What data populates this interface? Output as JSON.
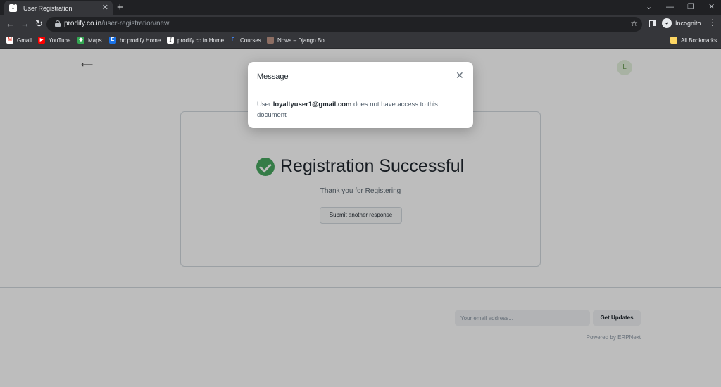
{
  "browser": {
    "tab_title": "User Registration",
    "tab_favicon": "f",
    "url_host": "prodify.co.in",
    "url_path": "/user-registration/new",
    "profile_label": "Incognito",
    "bookmarks": [
      {
        "label": "Gmail",
        "icon": "gmail-icon",
        "color": "#ea4335",
        "glyph": "M"
      },
      {
        "label": "YouTube",
        "icon": "youtube-icon",
        "color": "#ff0000",
        "glyph": "▶"
      },
      {
        "label": "Maps",
        "icon": "maps-icon",
        "color": "#34a853",
        "glyph": "◆"
      },
      {
        "label": "hc prodify Home",
        "icon": "site-icon",
        "color": "#1a73e8",
        "glyph": "E"
      },
      {
        "label": "prodify.co.in Home",
        "icon": "site-icon",
        "color": "#ffffff",
        "glyph": "f"
      },
      {
        "label": "Courses",
        "icon": "site-icon",
        "color": "#4285f4",
        "glyph": "F"
      },
      {
        "label": "Nowa – Django Bo...",
        "icon": "site-icon",
        "color": "#8d6e63",
        "glyph": ""
      }
    ],
    "all_bookmarks_label": "All Bookmarks"
  },
  "page": {
    "back_arrow": "⟵",
    "user_avatar_initial": "L",
    "success_title": "Registration Successful",
    "thanks_text": "Thank you for Registering",
    "submit_another_label": "Submit another response",
    "email_placeholder": "Your email address...",
    "get_updates_label": "Get Updates",
    "powered_by": "Powered by ERPNext"
  },
  "modal": {
    "title": "Message",
    "close_glyph": "✕",
    "body_prefix": "User ",
    "body_email": "loyaltyuser1@gmail.com",
    "body_suffix": " does not have access to this document"
  },
  "colors": {
    "success": "#48a860",
    "overlay": "rgba(0,0,0,0.26)"
  }
}
